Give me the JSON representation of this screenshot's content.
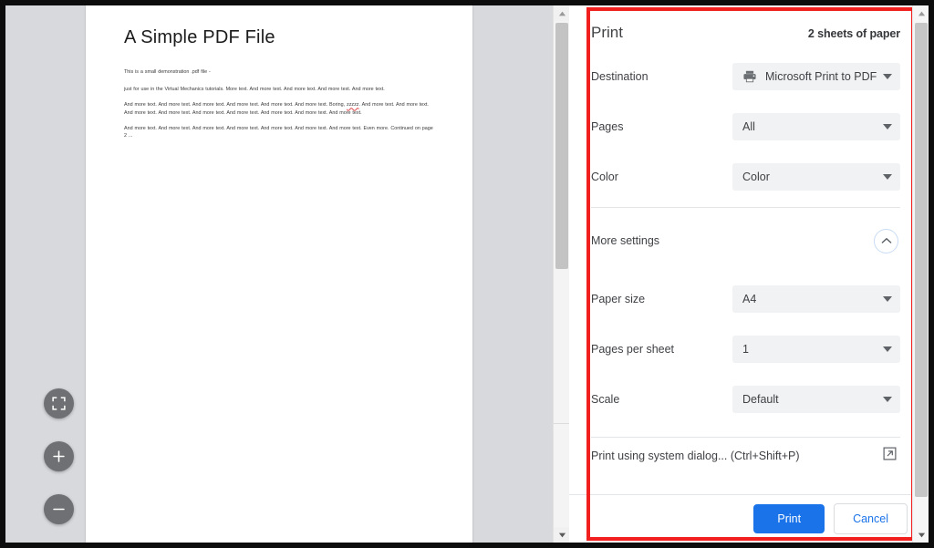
{
  "document": {
    "title": "A Simple PDF File",
    "paragraphs": [
      "This is a small demonstration .pdf file -",
      "just for use in the Virtual Mechanics tutorials. More text. And more text. And more text. And more text. And more text.",
      "And more text. And more text. And more text. And more text. And more text. And more text. Boring, zzzzz. And more text. And more text. And more text. And more text. And more text. And more text. And more text. And more text. And more text.",
      "And more text. And more text. And more text. And more text. And more text. And more text. And more text. Even more. Continued on page 2 ..."
    ],
    "misspelled_word": "zzzzz"
  },
  "viewer": {
    "controls": [
      {
        "name": "fit-to-page",
        "label": "Fit to page"
      },
      {
        "name": "zoom-in",
        "label": "Zoom in"
      },
      {
        "name": "zoom-out",
        "label": "Zoom out"
      }
    ]
  },
  "print_dialog": {
    "title": "Print",
    "sheets": "2 sheets of paper",
    "settings": [
      {
        "label": "Destination",
        "value": "Microsoft Print to PDF",
        "icon": "printer-icon"
      },
      {
        "label": "Pages",
        "value": "All",
        "icon": ""
      },
      {
        "label": "Color",
        "value": "Color",
        "icon": ""
      }
    ],
    "more_settings": {
      "label": "More settings",
      "expanded": true,
      "toggle_icon": "chevron-up-icon"
    },
    "advanced_settings": [
      {
        "label": "Paper size",
        "value": "A4"
      },
      {
        "label": "Pages per sheet",
        "value": "1"
      },
      {
        "label": "Scale",
        "value": "Default"
      }
    ],
    "system_dialog": {
      "label": "Print using system dialog... (Ctrl+Shift+P)",
      "icon": "external-link-icon"
    },
    "buttons": {
      "print": "Print",
      "cancel": "Cancel"
    },
    "colors": {
      "accent": "#1a73e8",
      "highlight_border": "#f21f1f",
      "select_bg": "#f1f2f3",
      "text": "#3f4145"
    }
  }
}
